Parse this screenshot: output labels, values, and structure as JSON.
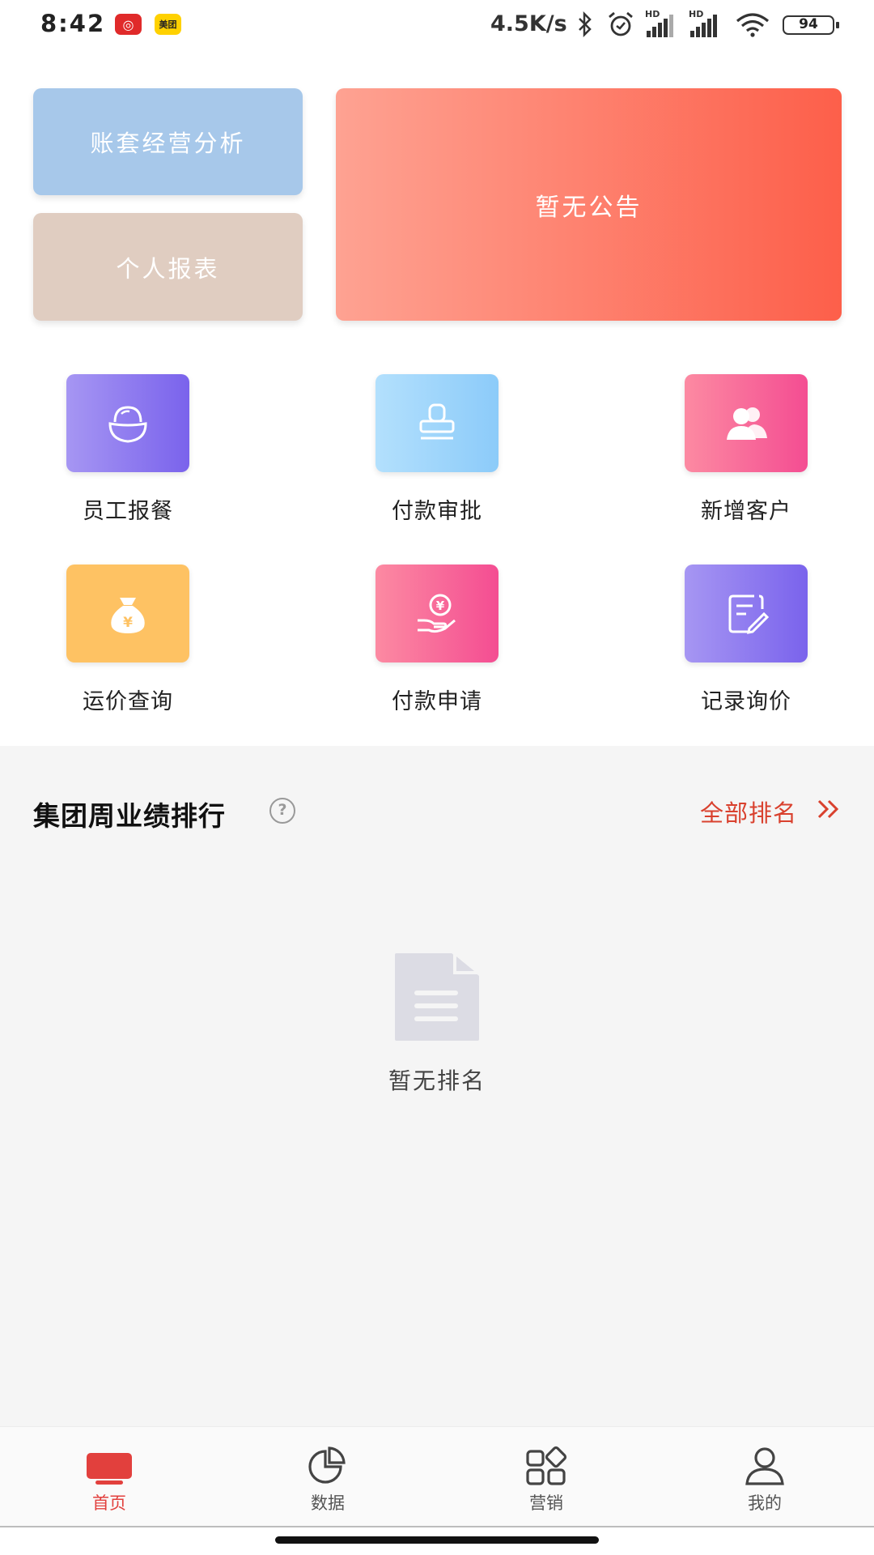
{
  "status_bar": {
    "time": "8:42",
    "apps": [
      "weibo-icon",
      "美团"
    ],
    "net_speed": "4.5K/s",
    "battery": "94",
    "signal_label": "HD"
  },
  "cards": {
    "analysis": "账套经营分析",
    "report": "个人报表",
    "notice": "暂无公告"
  },
  "grid": [
    {
      "label": "员工报餐",
      "icon": "rice-bowl-icon"
    },
    {
      "label": "付款审批",
      "icon": "stamp-icon"
    },
    {
      "label": "新增客户",
      "icon": "users-icon"
    },
    {
      "label": "运价查询",
      "icon": "money-bag-icon"
    },
    {
      "label": "付款申请",
      "icon": "hand-coin-icon"
    },
    {
      "label": "记录询价",
      "icon": "edit-note-icon"
    }
  ],
  "ranking": {
    "title": "集团周业绩排行",
    "help": "?",
    "all_link": "全部排名",
    "empty_text": "暂无排名"
  },
  "tabs": [
    {
      "label": "首页",
      "icon": "home-icon",
      "active": true
    },
    {
      "label": "数据",
      "icon": "pie-chart-icon",
      "active": false
    },
    {
      "label": "营销",
      "icon": "apps-grid-icon",
      "active": false
    },
    {
      "label": "我的",
      "icon": "user-icon",
      "active": false
    }
  ],
  "colors": {
    "accent": "#e2403d",
    "link": "#d9412e",
    "notice_gradient": [
      "#fea292",
      "#fd5f4a"
    ]
  }
}
